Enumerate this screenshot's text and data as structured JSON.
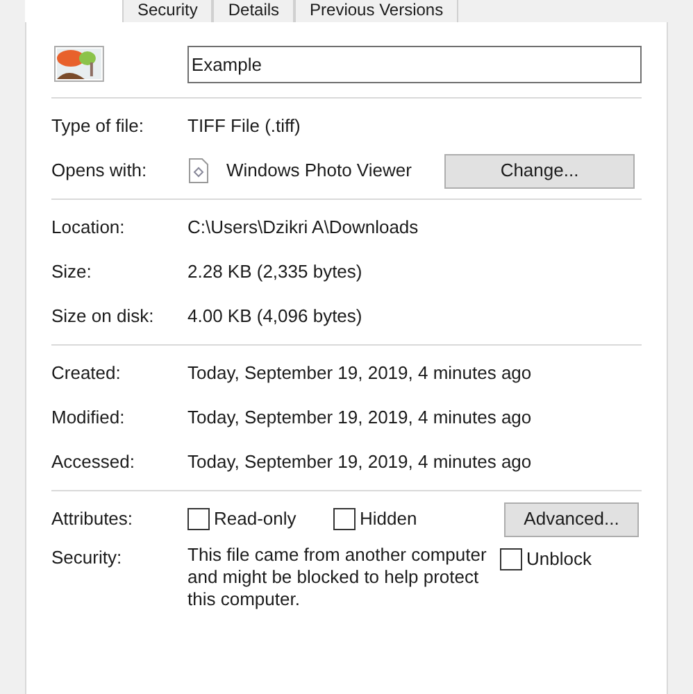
{
  "tabs": [
    {
      "label": "Security",
      "selected": false
    },
    {
      "label": "Details",
      "selected": false
    },
    {
      "label": "Previous Versions",
      "selected": false
    }
  ],
  "file_name": {
    "value": "Example"
  },
  "type_section": [
    {
      "label": "Type of file:",
      "value": "TIFF File (.tiff)"
    },
    {
      "label": "Opens with:",
      "value": "Windows Photo Viewer",
      "button": "Change..."
    }
  ],
  "location_section": [
    {
      "label": "Location:",
      "value": "C:\\Users\\Dzikri A\\Downloads"
    },
    {
      "label": "Size:",
      "value": "2.28 KB (2,335 bytes)"
    },
    {
      "label": "Size on disk:",
      "value": "4.00 KB (4,096 bytes)"
    }
  ],
  "dates_section": [
    {
      "label": "Created:",
      "value": "Today, September 19, 2019, 4 minutes ago"
    },
    {
      "label": "Modified:",
      "value": "Today, September 19, 2019, 4 minutes ago"
    },
    {
      "label": "Accessed:",
      "value": "Today, September 19, 2019, 4 minutes ago"
    }
  ],
  "attributes": {
    "label": "Attributes:",
    "options": [
      {
        "label": "Read-only",
        "checked": false
      },
      {
        "label": "Hidden",
        "checked": false
      }
    ],
    "button": "Advanced..."
  },
  "security": {
    "label": "Security:",
    "text": "This file came from another computer and might be blocked to help protect this computer.",
    "unblock": {
      "label": "Unblock",
      "checked": false
    }
  }
}
